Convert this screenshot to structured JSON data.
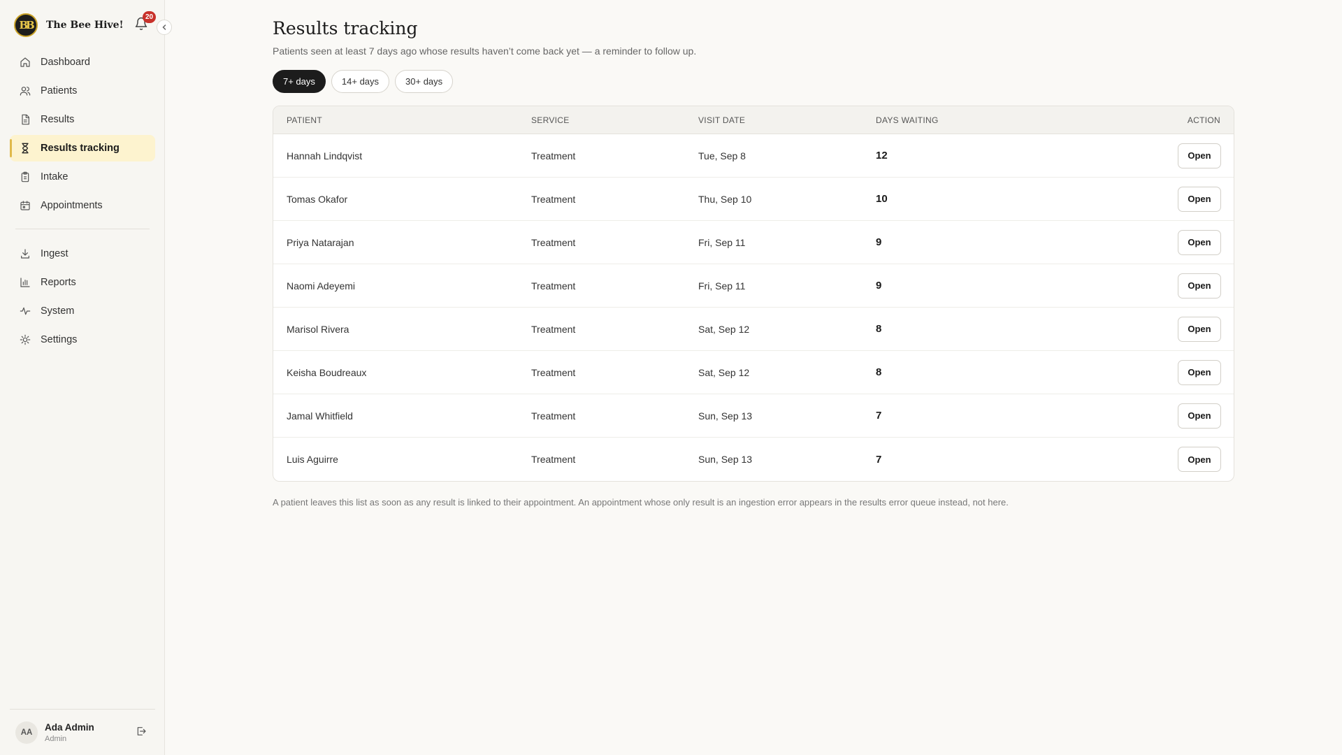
{
  "app": {
    "brand_name": "The Bee Hive!",
    "logo_letters": "BB",
    "notification_count": "20"
  },
  "sidebar": {
    "items": [
      {
        "label": "Dashboard",
        "icon": "home-icon"
      },
      {
        "label": "Patients",
        "icon": "users-icon"
      },
      {
        "label": "Results",
        "icon": "document-icon"
      },
      {
        "label": "Results tracking",
        "icon": "hourglass-icon",
        "active": true
      },
      {
        "label": "Intake",
        "icon": "clipboard-icon"
      },
      {
        "label": "Appointments",
        "icon": "calendar-icon"
      }
    ],
    "secondary_items": [
      {
        "label": "Ingest",
        "icon": "download-icon"
      },
      {
        "label": "Reports",
        "icon": "bar-chart-icon"
      },
      {
        "label": "System",
        "icon": "activity-icon"
      },
      {
        "label": "Settings",
        "icon": "sun-gear-icon"
      }
    ],
    "user": {
      "initials": "AA",
      "name": "Ada Admin",
      "role": "Admin"
    }
  },
  "page": {
    "title": "Results tracking",
    "subtitle": "Patients seen at least 7 days ago whose results haven’t come back yet — a reminder to follow up.",
    "filters": [
      {
        "label": "7+ days",
        "active": true
      },
      {
        "label": "14+ days",
        "active": false
      },
      {
        "label": "30+ days",
        "active": false
      }
    ],
    "footnote": "A patient leaves this list as soon as any result is linked to their appointment. An appointment whose only result is an ingestion error appears in the results error queue instead, not here."
  },
  "table": {
    "columns": [
      "PATIENT",
      "SERVICE",
      "VISIT DATE",
      "DAYS WAITING",
      "ACTION"
    ],
    "action_label": "Open",
    "rows": [
      {
        "patient": "Hannah Lindqvist",
        "service": "Treatment",
        "visit_date": "Tue, Sep 8",
        "days_waiting": "12"
      },
      {
        "patient": "Tomas Okafor",
        "service": "Treatment",
        "visit_date": "Thu, Sep 10",
        "days_waiting": "10"
      },
      {
        "patient": "Priya Natarajan",
        "service": "Treatment",
        "visit_date": "Fri, Sep 11",
        "days_waiting": "9"
      },
      {
        "patient": "Naomi Adeyemi",
        "service": "Treatment",
        "visit_date": "Fri, Sep 11",
        "days_waiting": "9"
      },
      {
        "patient": "Marisol Rivera",
        "service": "Treatment",
        "visit_date": "Sat, Sep 12",
        "days_waiting": "8"
      },
      {
        "patient": "Keisha Boudreaux",
        "service": "Treatment",
        "visit_date": "Sat, Sep 12",
        "days_waiting": "8"
      },
      {
        "patient": "Jamal Whitfield",
        "service": "Treatment",
        "visit_date": "Sun, Sep 13",
        "days_waiting": "7"
      },
      {
        "patient": "Luis Aguirre",
        "service": "Treatment",
        "visit_date": "Sun, Sep 13",
        "days_waiting": "7"
      }
    ]
  },
  "colors": {
    "accent": "#e0b94a",
    "active_nav_bg": "#fdf3cf",
    "badge": "#c8312a",
    "active_pill": "#1c1c1c"
  }
}
